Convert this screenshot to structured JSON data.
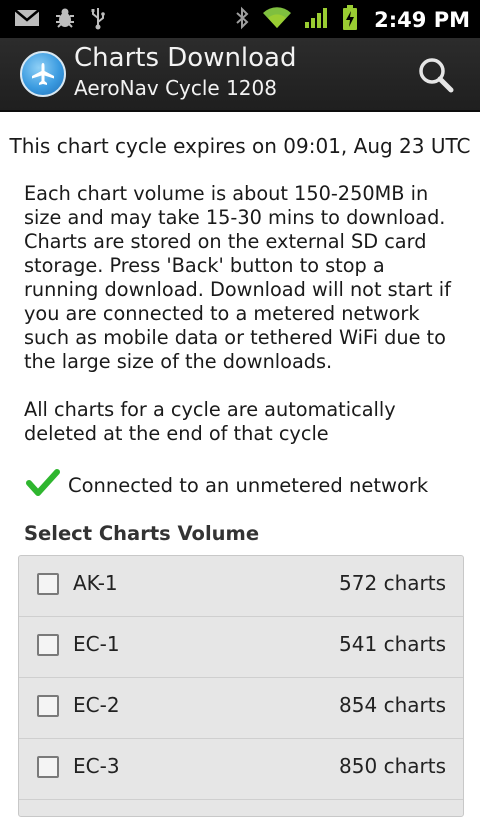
{
  "status_bar": {
    "time": "2:49 PM",
    "icons": [
      "gmail-icon",
      "debug-icon",
      "usb-icon",
      "bluetooth-icon",
      "wifi-icon",
      "signal-icon",
      "battery-charging-icon"
    ]
  },
  "action_bar": {
    "title": "Charts Download",
    "subtitle": "AeroNav Cycle 1208",
    "icons": [
      "airplane-app-icon",
      "search-icon"
    ]
  },
  "main": {
    "expires_text": "This chart cycle expires on 09:01, Aug 23 UTC",
    "info_text": "Each chart volume is about 150-250MB in size and may take 15-30 mins to download. Charts are stored on the external SD card storage. Press 'Back' button to stop a running download. Download will not start if you are connected to a metered network such as mobile data or tethered WiFi due to the large size of the downloads.",
    "delete_text": "All charts for a cycle are automatically deleted at the end of that cycle",
    "network_status": "Connected to an unmetered network",
    "select_title": "Select Charts Volume",
    "volumes": [
      {
        "name": "AK-1",
        "count": "572 charts",
        "checked": false
      },
      {
        "name": "EC-1",
        "count": "541 charts",
        "checked": false
      },
      {
        "name": "EC-2",
        "count": "854 charts",
        "checked": false
      },
      {
        "name": "EC-3",
        "count": "850 charts",
        "checked": false
      }
    ]
  },
  "colors": {
    "status_bar_bg": "#000000",
    "action_bar_bg": "#262626",
    "check_green": "#2fb62f",
    "list_bg": "#e6e6e6",
    "signal_green": "#9acd32"
  }
}
